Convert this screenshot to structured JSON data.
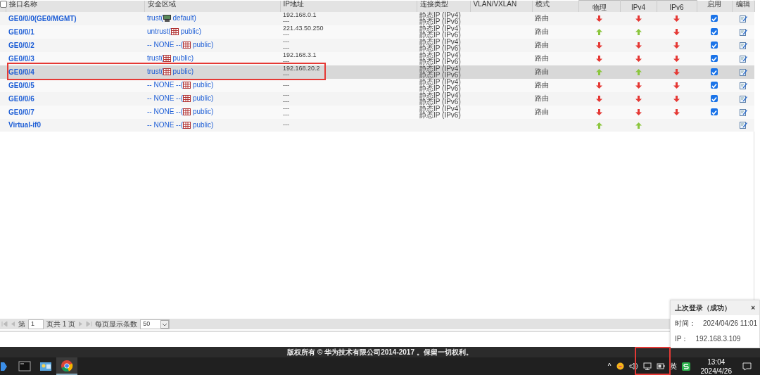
{
  "table": {
    "header_checkbox": {
      "checked": false
    },
    "columns": [
      "接口名称",
      "安全区域",
      "IP地址",
      "连接类型",
      "VLAN/VXLAN",
      "模式",
      "物理",
      "IPv4",
      "IPv6",
      "启用",
      "编辑"
    ],
    "rows": [
      {
        "name": "GE0/0/0(GE0/MGMT)",
        "zone": {
          "kind": "host",
          "name": "trust(",
          "vsys": "default)"
        },
        "ip": [
          "192.168.0.1",
          "---"
        ],
        "conn": [
          "静态IP (IPv4)",
          "静态IP (IPv6)"
        ],
        "mode": "路由",
        "phys_up": false,
        "ipv4_up": false,
        "ipv6_up": false,
        "enabled": true,
        "selected": false
      },
      {
        "name": "GE0/0/1",
        "zone": {
          "kind": "grid",
          "name": "untrust(",
          "vsys": "public)"
        },
        "ip": [
          "221.43.50.250",
          "---"
        ],
        "conn": [
          "静态IP (IPv4)",
          "静态IP (IPv6)"
        ],
        "mode": "路由",
        "phys_up": true,
        "ipv4_up": true,
        "ipv6_up": false,
        "enabled": true,
        "selected": false
      },
      {
        "name": "GE0/0/2",
        "zone": {
          "kind": "grid",
          "name": "-- NONE --(",
          "vsys": "public)"
        },
        "ip": [
          "---",
          "---"
        ],
        "conn": [
          "静态IP (IPv4)",
          "静态IP (IPv6)"
        ],
        "mode": "路由",
        "phys_up": false,
        "ipv4_up": false,
        "ipv6_up": false,
        "enabled": true,
        "selected": false
      },
      {
        "name": "GE0/0/3",
        "zone": {
          "kind": "grid",
          "name": "trust(",
          "vsys": "public)"
        },
        "ip": [
          "192.168.3.1",
          "---"
        ],
        "conn": [
          "静态IP (IPv4)",
          "静态IP (IPv6)"
        ],
        "mode": "路由",
        "phys_up": false,
        "ipv4_up": false,
        "ipv6_up": false,
        "enabled": true,
        "selected": false
      },
      {
        "name": "GE0/0/4",
        "zone": {
          "kind": "grid",
          "name": "trust(",
          "vsys": "public)"
        },
        "ip": [
          "192.168.20.2",
          "---"
        ],
        "conn": [
          "静态IP (IPv4)",
          "静态IP (IPv6)"
        ],
        "mode": "路由",
        "phys_up": true,
        "ipv4_up": true,
        "ipv6_up": false,
        "enabled": true,
        "selected": true
      },
      {
        "name": "GE0/0/5",
        "zone": {
          "kind": "grid",
          "name": "-- NONE --(",
          "vsys": "public)"
        },
        "ip": [
          "---"
        ],
        "conn": [
          "静态IP (IPv4)",
          "静态IP (IPv6)"
        ],
        "mode": "路由",
        "phys_up": false,
        "ipv4_up": false,
        "ipv6_up": false,
        "enabled": true,
        "selected": false
      },
      {
        "name": "GE0/0/6",
        "zone": {
          "kind": "grid",
          "name": "-- NONE --(",
          "vsys": "public)"
        },
        "ip": [
          "---",
          "---"
        ],
        "conn": [
          "静态IP (IPv4)",
          "静态IP (IPv6)"
        ],
        "mode": "路由",
        "phys_up": false,
        "ipv4_up": false,
        "ipv6_up": false,
        "enabled": true,
        "selected": false
      },
      {
        "name": "GE0/0/7",
        "zone": {
          "kind": "grid",
          "name": "-- NONE --(",
          "vsys": "public)"
        },
        "ip": [
          "---",
          "---"
        ],
        "conn": [
          "静态IP (IPv4)",
          "静态IP (IPv6)"
        ],
        "mode": "路由",
        "phys_up": false,
        "ipv4_up": false,
        "ipv6_up": false,
        "enabled": true,
        "selected": false
      },
      {
        "name": "Virtual-if0",
        "zone": {
          "kind": "grid",
          "name": "-- NONE --(",
          "vsys": "public)"
        },
        "ip": [
          "---"
        ],
        "conn": [],
        "phys_up": true,
        "ipv4_up": true,
        "selected": false
      }
    ]
  },
  "pager": {
    "page_prefix": "第",
    "page": "1",
    "page_suffix": "页共 1 页",
    "per_page_label": "每页显示条数",
    "per_page": "50"
  },
  "footer": "版权所有 © 华为技术有限公司2014-2017 。保留一切权利。",
  "login_popup": {
    "title": "上次登录（成功）",
    "close": "×",
    "rows": [
      {
        "label": "时间：",
        "value": "2024/04/26 11:01"
      },
      {
        "label": "IP：",
        "value": "192.168.3.109"
      }
    ]
  },
  "taskbar": {
    "apps": [
      {
        "kind": "partial",
        "active": false
      },
      {
        "kind": "terminal",
        "active": false
      },
      {
        "kind": "picture",
        "active": false
      },
      {
        "kind": "browser",
        "active": true
      }
    ],
    "tray_chevron": "^",
    "ime": "英",
    "time": "13:04",
    "date": "2024/4/26"
  }
}
